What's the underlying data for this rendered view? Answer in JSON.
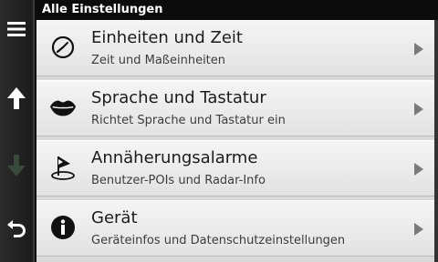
{
  "header": {
    "title": "Alle Einstellungen"
  },
  "sidebar": {
    "items": [
      {
        "icon": "menu-icon"
      },
      {
        "icon": "arrow-up-icon"
      },
      {
        "icon": "arrow-down-icon"
      },
      {
        "icon": "back-icon"
      }
    ]
  },
  "settings": [
    {
      "icon": "clock-icon",
      "title": "Einheiten und Zeit",
      "subtitle": "Zeit und Maßeinheiten"
    },
    {
      "icon": "lips-icon",
      "title": "Sprache und Tastatur",
      "subtitle": "Richtet Sprache und Tastatur ein"
    },
    {
      "icon": "proximity-alert-icon",
      "title": "Annäherungsalarme",
      "subtitle": "Benutzer-POIs und Radar-Info"
    },
    {
      "icon": "info-icon",
      "title": "Gerät",
      "subtitle": "Geräteinfos und Datenschutzeinstellungen"
    }
  ],
  "colors": {
    "titlebar": "#0c0c0c",
    "row_bg": "#efefef",
    "text": "#1b1b1b",
    "disabled_arrow": "#3a4a3a"
  }
}
